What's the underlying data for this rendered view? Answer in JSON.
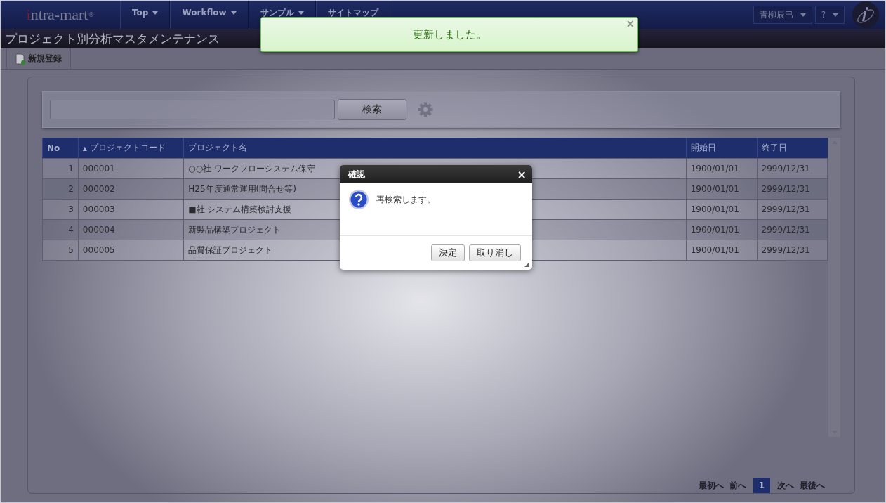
{
  "header": {
    "logo": "intra-mart",
    "logo_mark": "®",
    "nav": [
      {
        "label": "Top",
        "dropdown": true
      },
      {
        "label": "Workflow",
        "dropdown": true
      },
      {
        "label": "サンプル",
        "dropdown": true
      },
      {
        "label": "サイトマップ",
        "dropdown": false
      }
    ],
    "user_menu": "青柳辰巳",
    "help_menu": "?"
  },
  "page_title": "プロジェクト別分析マスタメンテナンス",
  "toolbar": {
    "buttons": [
      "新規登録"
    ]
  },
  "search": {
    "button": "検索"
  },
  "table": {
    "columns": [
      {
        "label": "No"
      },
      {
        "label": "プロジェクトコード",
        "sort_mark": "▲"
      },
      {
        "label": "プロジェクト名"
      },
      {
        "label": "開始日"
      },
      {
        "label": "終了日"
      }
    ],
    "rows": [
      [
        "1",
        "000001",
        "○○社 ワークフローシステム保守",
        "1900/01/01",
        "2999/12/31"
      ],
      [
        "2",
        "000002",
        "H25年度通常運用(問合せ等)",
        "1900/01/01",
        "2999/12/31"
      ],
      [
        "3",
        "000003",
        "■社 システム構築検討支援",
        "1900/01/01",
        "2999/12/31"
      ],
      [
        "4",
        "000004",
        "新製品構築プロジェクト",
        "1900/01/01",
        "2999/12/31"
      ],
      [
        "5",
        "000005",
        "品質保証プロジェクト",
        "1900/01/01",
        "2999/12/31"
      ]
    ]
  },
  "pager": [
    {
      "label": "最初へ",
      "kind": "link",
      "selected": false
    },
    {
      "label": "前へ",
      "kind": "link",
      "selected": false
    },
    {
      "label": "1",
      "kind": "page",
      "selected": true
    },
    {
      "label": "次へ",
      "kind": "link",
      "selected": false
    },
    {
      "label": "最後へ",
      "kind": "link",
      "selected": false
    }
  ],
  "dialog": {
    "title": "確認",
    "close": "×",
    "message": "再検索します。",
    "buttons": [
      "決定",
      "取り消し"
    ]
  },
  "toast": {
    "message": "更新しました。",
    "close": "×"
  }
}
